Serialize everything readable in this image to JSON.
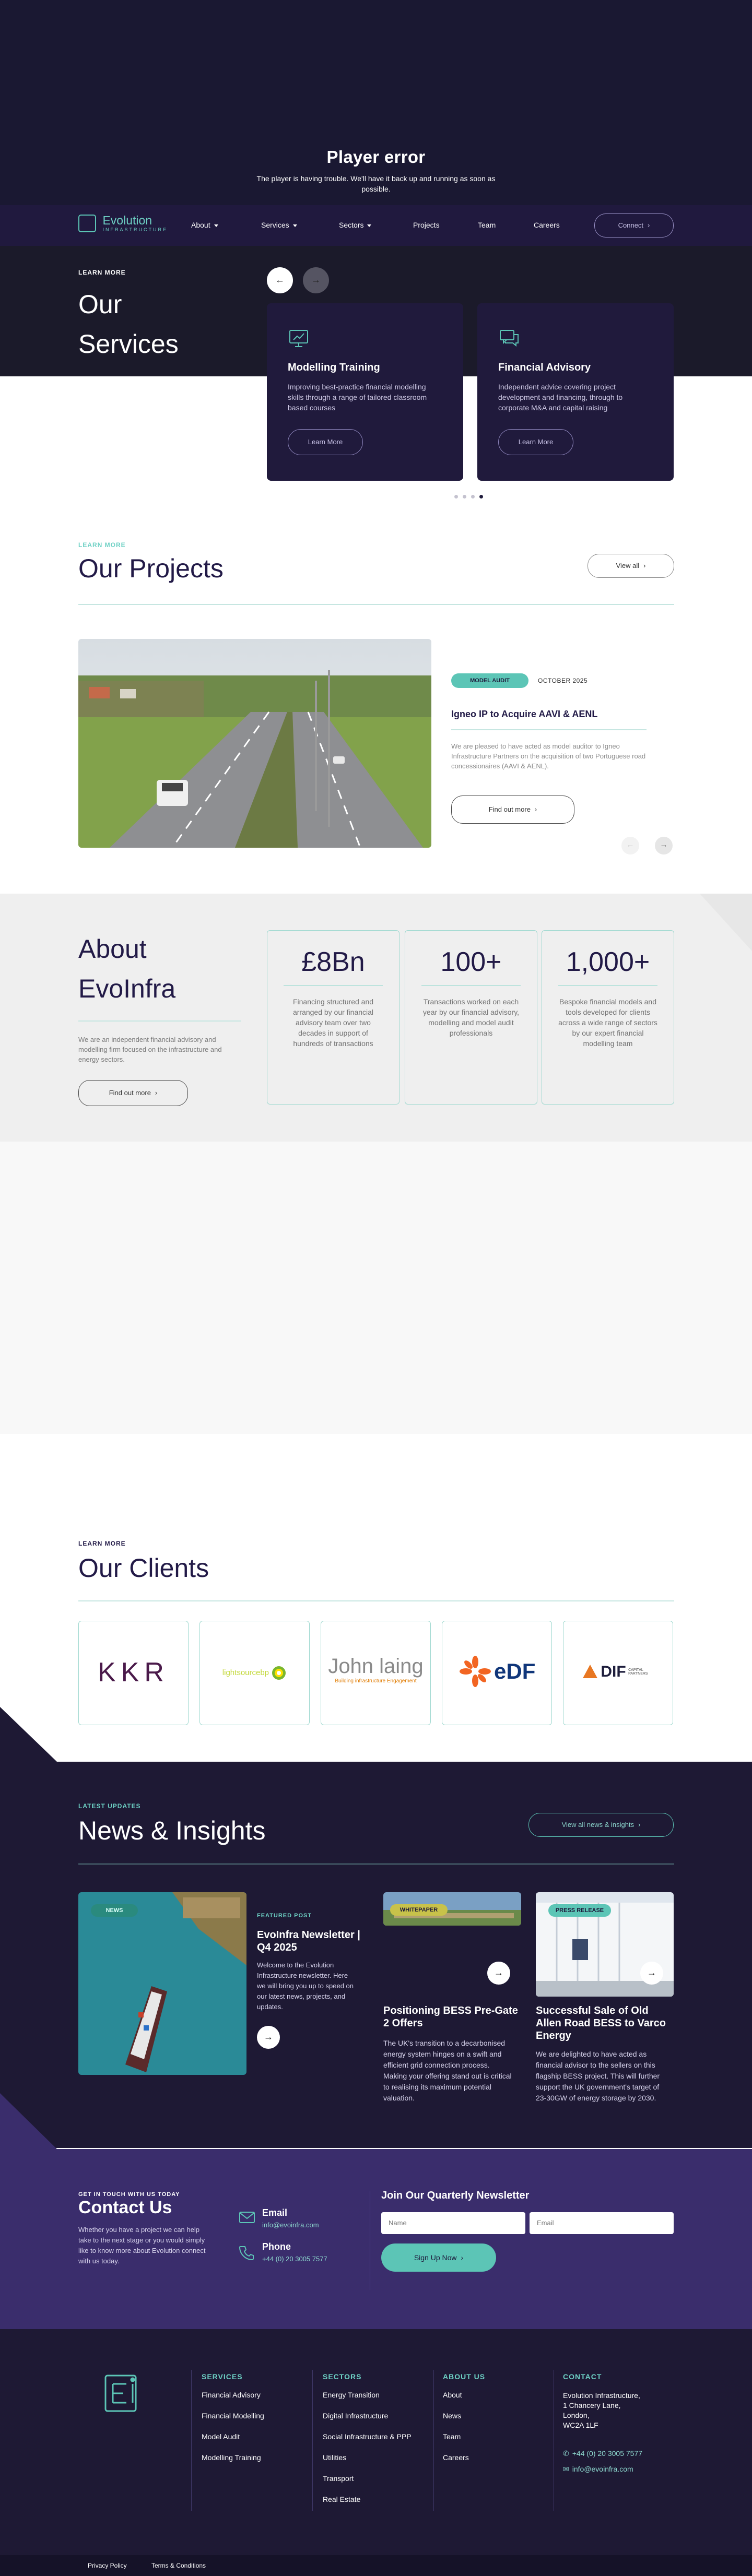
{
  "player_error": {
    "title": "Player error",
    "message_line1": "The player is having trouble. We'll have it back up and running as soon as",
    "message_line2": "possible."
  },
  "nav": {
    "logo_word": "Evolution",
    "logo_sub": "INFRASTRUCTURE",
    "items": [
      "About",
      "Services",
      "Sectors",
      "Projects",
      "Team",
      "Careers"
    ],
    "connect": "Connect"
  },
  "services": {
    "kicker": "LEARN MORE",
    "heading_line1": "Our",
    "heading_line2": "Services",
    "cards": [
      {
        "title": "Modelling Training",
        "desc": "Improving best-practice financial modelling skills through a range of tailored classroom based courses",
        "cta": "Learn More",
        "icon": "chart-presentation-icon"
      },
      {
        "title": "Financial Advisory",
        "desc": "Independent advice covering project development and financing, through to corporate M&A and capital raising",
        "cta": "Learn More",
        "icon": "chat-bubbles-icon"
      }
    ],
    "carousel_dots": 4,
    "active_dot": 3
  },
  "projects": {
    "kicker": "LEARN MORE",
    "heading": "Our Projects",
    "view_all": "View all",
    "tag": "MODEL AUDIT",
    "date": "OCTOBER 2025",
    "title": "Igneo IP to Acquire AAVI & AENL",
    "desc": "We are pleased to have acted as model auditor to Igneo Infrastructure Partners on the acquisition of two Portuguese road concessionaires (AAVI & AENL).",
    "cta": "Find out more"
  },
  "about": {
    "heading_line1": "About",
    "heading_line2": "EvoInfra",
    "desc": "We are an independent financial advisory and modelling firm focused on the infrastructure and energy sectors.",
    "cta": "Find out more",
    "stats": [
      {
        "value": "£8Bn",
        "desc": "Financing structured and arranged by our financial advisory team over two decades in support of hundreds of transactions"
      },
      {
        "value": "100+",
        "desc": "Transactions worked on each year by our financial advisory, modelling and model audit professionals"
      },
      {
        "value": "1,000+",
        "desc": "Bespoke financial models and tools developed for clients across a wide range of sectors by our expert financial modelling team"
      }
    ]
  },
  "clients": {
    "kicker": "LEARN MORE",
    "heading": "Our Clients",
    "logos": [
      {
        "name": "KKR",
        "text": "KKR"
      },
      {
        "name": "lightsourcebp",
        "text": "lightsourcebp"
      },
      {
        "name": "John Laing",
        "text": "John laing",
        "sub": "Building infrastructure Engagement"
      },
      {
        "name": "EDF",
        "text": "eDF"
      },
      {
        "name": "DIF",
        "text": "DIF",
        "sub": "CAPITAL PARTNERS"
      }
    ]
  },
  "news": {
    "kicker": "LATEST UPDATES",
    "heading": "News & Insights",
    "view_all": "View all news & insights",
    "featured_badge": "NEWS",
    "featured_label": "FEATURED POST",
    "featured_title": "EvoInfra Newsletter | Q4 2025",
    "featured_desc": "Welcome to the Evolution Infrastructure newsletter. Here we will bring you up to speed on our latest news, projects, and updates.",
    "items": [
      {
        "badge": "WHITEPAPER",
        "title": "Positioning BESS Pre-Gate 2 Offers",
        "desc": "The UK's transition to a decarbonised energy system hinges on a swift and efficient grid connection process. Making your offering stand out is critical to realising its maximum potential valuation."
      },
      {
        "badge": "PRESS RELEASE",
        "title": "Successful Sale of Old Allen Road BESS to Varco Energy",
        "desc": "We are delighted to have acted as financial advisor to the sellers on this flagship BESS project. This will further support the UK government's target of 23-30GW of energy storage by 2030."
      }
    ]
  },
  "contact": {
    "kicker": "GET IN TOUCH WITH US TODAY",
    "heading": "Contact Us",
    "desc": "Whether you have a project we can help take to the next stage or you would simply like to know more about Evolution connect with us today.",
    "email_label": "Email",
    "email_value": "info@evoinfra.com",
    "phone_label": "Phone",
    "phone_value": "+44 (0) 20 3005 7577",
    "newsletter_heading": "Join Our Quarterly Newsletter",
    "name_placeholder": "Name",
    "email_placeholder": "Email",
    "signup": "Sign Up Now"
  },
  "footer": {
    "services_heading": "SERVICES",
    "services": [
      "Financial Advisory",
      "Financial Modelling",
      "Model Audit",
      "Modelling Training"
    ],
    "sectors_heading": "SECTORS",
    "sectors": [
      "Energy Transition",
      "Digital Infrastructure",
      "Social Infrastructure & PPP",
      "Utilities",
      "Transport",
      "Real Estate"
    ],
    "about_heading": "ABOUT US",
    "about": [
      "About",
      "News",
      "Team",
      "Careers"
    ],
    "contact_heading": "CONTACT",
    "address": [
      "Evolution Infrastructure,",
      "1 Chancery Lane,",
      "London,",
      "WC2A 1LF"
    ],
    "phone": "+44 (0) 20 3005 7577",
    "email": "info@evoinfra.com",
    "bottom_links": [
      "Privacy Policy",
      "Terms & Conditions"
    ]
  },
  "colors": {
    "navy": "#1f1a3b",
    "teal": "#5cc5b6",
    "purple": "#3a2d6c"
  }
}
